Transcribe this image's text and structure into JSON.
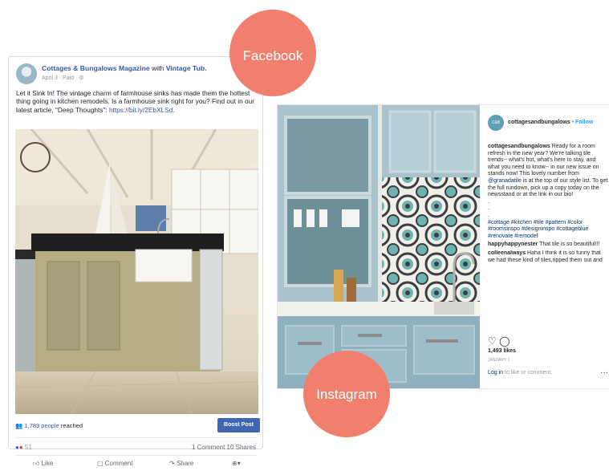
{
  "facebook": {
    "badge": "Facebook",
    "page_name": "Cottages & Bungalows Magazine",
    "with_word": " with ",
    "partner": "Vintage Tub.",
    "meta": "April 3 · Paid · ",
    "body": "Let it Sink In! The vintage charm of farmhouse sinks has made them the hottest thing going in kitchen remodels. Is a farmhouse sink right for you? Find out in our latest article, \"Deep Thoughts\": ",
    "link": "https://bit.ly/2EbXLSd.",
    "reach_count": "1,789 people",
    "reach_suffix": " reached",
    "boost_label": "Boost Post",
    "reaction_count": "51",
    "comment_share": "1 Comment 10 Shares",
    "like_label": "Like",
    "comment_label": "Comment",
    "share_label": "Share"
  },
  "instagram": {
    "badge": "Instagram",
    "avatar_text": "C&B",
    "handle": "cottagesandbungalows",
    "follow_sep": " • ",
    "follow": "Follow",
    "caption_user": "cottagesandbungalows",
    "caption_text": " Ready for a room refresh in the new year? We're talking tile trends-- what's hot, what's here to stay, and what you need to know-- in our new issue on stands now! This lovely number from ",
    "caption_mention": "@granadatile",
    "caption_tail": " is at the top of our style list. To get the full rundown, pick up a copy today on the newsstand or at the link in our bio!",
    "dot": ".",
    "hashtags": "#cottage #kitchen #tile #pattern #color #roomsinspo #designinspo #cottageblue #renovate #remodel",
    "comment1_user": "happyhappynester",
    "comment1_text": " That tile is so beautiful!!!",
    "comment2_user": "colleenalways",
    "comment2_text": " Haha I think it is so funny that we had these kind of tiles,ripped them out and now we put them back as they are",
    "likes": "1,493 likes",
    "date": "JANUARY 1",
    "login_link": "Log in",
    "login_rest": " to like or comment.",
    "more": "···"
  },
  "colors": {
    "badge": "#f07f6e",
    "facebook_blue": "#4267b2",
    "instagram_blue": "#3897f0"
  }
}
